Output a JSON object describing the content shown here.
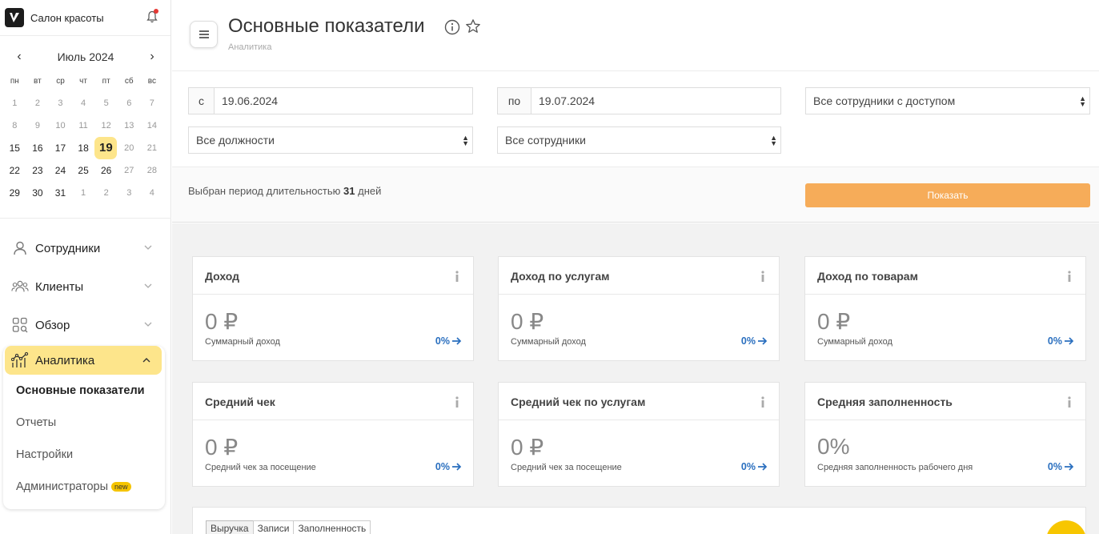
{
  "brand": {
    "name": "Салон красоты"
  },
  "calendar": {
    "month": "Июль 2024",
    "prev": "‹",
    "next": "›",
    "weekdays": [
      "пн",
      "вт",
      "ср",
      "чт",
      "пт",
      "сб",
      "вс"
    ],
    "weeks": [
      [
        "1",
        "2",
        "3",
        "4",
        "5",
        "6",
        "7"
      ],
      [
        "8",
        "9",
        "10",
        "11",
        "12",
        "13",
        "14"
      ],
      [
        "15",
        "16",
        "17",
        "18",
        "19",
        "20",
        "21"
      ],
      [
        "22",
        "23",
        "24",
        "25",
        "26",
        "27",
        "28"
      ],
      [
        "29",
        "30",
        "31",
        "1",
        "2",
        "3",
        "4"
      ]
    ],
    "today": "19"
  },
  "nav": {
    "items": [
      {
        "label": "Сотрудники",
        "icon": "person-icon"
      },
      {
        "label": "Клиенты",
        "icon": "people-icon"
      },
      {
        "label": "Обзор",
        "icon": "grid-search-icon"
      }
    ],
    "active": {
      "label": "Аналитика",
      "icon": "analytics-icon"
    },
    "sub_items": [
      {
        "label": "Основные показатели",
        "selected": true
      },
      {
        "label": "Отчеты"
      },
      {
        "label": "Настройки"
      },
      {
        "label": "Администраторы",
        "badge": "new"
      }
    ]
  },
  "header": {
    "title": "Основные показатели",
    "breadcrumb": "Аналитика"
  },
  "filters": {
    "from_prefix": "с",
    "from_value": "19.06.2024",
    "to_prefix": "по",
    "to_value": "19.07.2024",
    "staff_access": "Все сотрудники с доступом",
    "positions": "Все должности",
    "staff": "Все сотрудники"
  },
  "period": {
    "text_before": "Выбран период длительностью",
    "days": "31",
    "text_after": "дней",
    "show_button": "Показать"
  },
  "cards": [
    {
      "title": "Доход",
      "value": "0 ₽",
      "sub": "Суммарный доход",
      "pct": "0%"
    },
    {
      "title": "Доход по услугам",
      "value": "0 ₽",
      "sub": "Суммарный доход",
      "pct": "0%"
    },
    {
      "title": "Доход по товарам",
      "value": "0 ₽",
      "sub": "Суммарный доход",
      "pct": "0%"
    },
    {
      "title": "Средний чек",
      "value": "0 ₽",
      "sub": "Средний чек за посещение",
      "pct": "0%"
    },
    {
      "title": "Средний чек по услугам",
      "value": "0 ₽",
      "sub": "Средний чек за посещение",
      "pct": "0%"
    },
    {
      "title": "Средняя заполненность",
      "value": "0%",
      "sub": "Средняя заполненность рабочего дня",
      "pct": "0%"
    }
  ],
  "tabs": [
    "Выручка",
    "Записи",
    "Заполненность"
  ],
  "colors": {
    "accent_yellow": "#fde58b",
    "button_orange": "#f6ac59",
    "link_blue": "#2a6fbf"
  }
}
